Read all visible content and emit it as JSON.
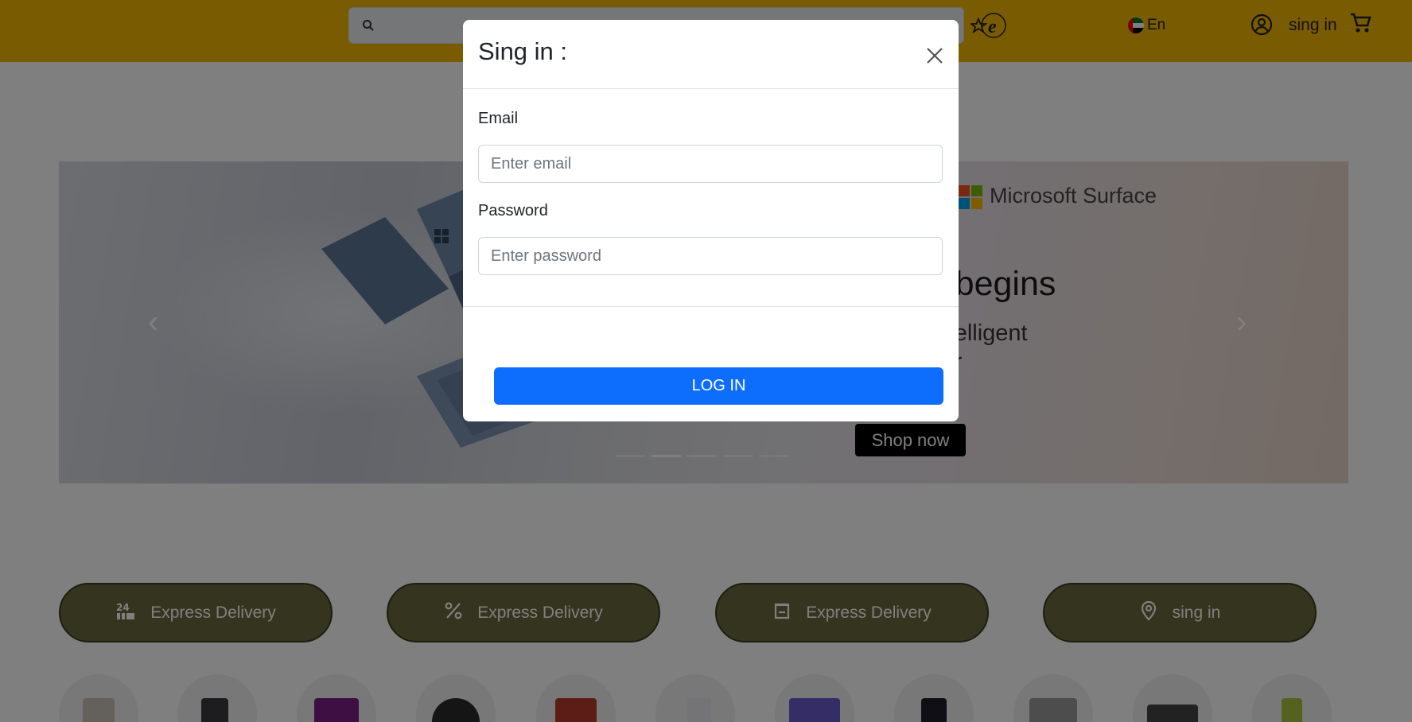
{
  "header": {
    "search": {
      "placeholder": "",
      "value": ""
    },
    "language": "En",
    "signin_label": "sing in"
  },
  "banner": {
    "brand": "Microsoft Surface",
    "headline": "AI era begins",
    "subline_1": "t, most intelligent",
    "subline_2": "ptops ever",
    "cta": "Shop now",
    "slide_count": 5,
    "active_slide": 2
  },
  "features": [
    {
      "label": "Express Delivery",
      "icon": "24h-delivery-icon"
    },
    {
      "label": "Express Delivery",
      "icon": "percent-icon"
    },
    {
      "label": "Express Delivery",
      "icon": "store-icon"
    },
    {
      "label": "sing in",
      "icon": "location-pin-icon"
    }
  ],
  "modal": {
    "title": "Sing in :",
    "email_label": "Email",
    "email_placeholder": "Enter email",
    "password_label": "Password",
    "password_placeholder": "Enter password",
    "submit_label": "LOG IN"
  },
  "colors": {
    "header_bg": "#f2b705",
    "primary": "#0d6efd",
    "pill_bg": "#6b6a3e"
  }
}
